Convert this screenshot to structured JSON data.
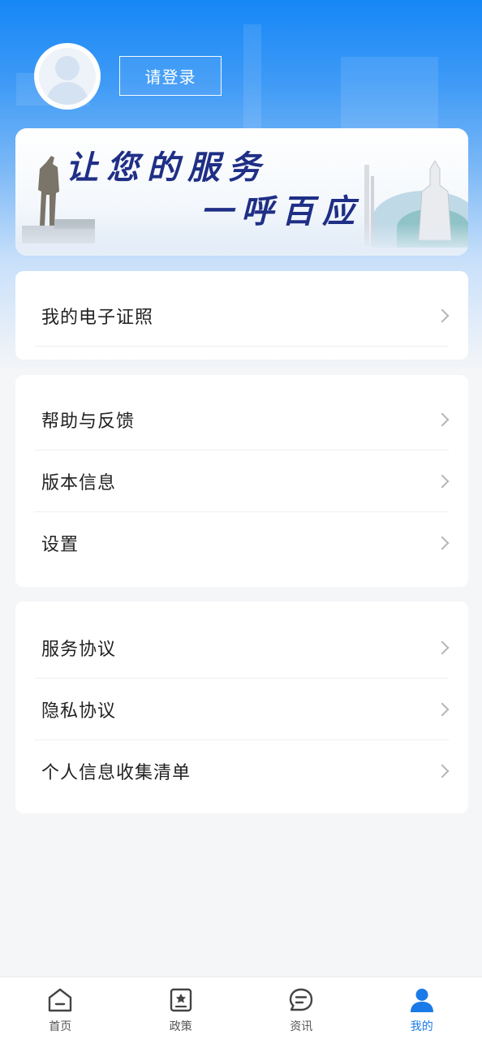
{
  "header": {
    "login_label": "请登录"
  },
  "banner": {
    "line1": "让您的服务",
    "line2": "一呼百应"
  },
  "menu_groups": [
    {
      "items": [
        {
          "label": "我的电子证照"
        }
      ]
    },
    {
      "items": [
        {
          "label": "帮助与反馈"
        },
        {
          "label": "版本信息"
        },
        {
          "label": "设置"
        }
      ]
    },
    {
      "items": [
        {
          "label": "服务协议"
        },
        {
          "label": "隐私协议"
        },
        {
          "label": "个人信息收集清单"
        }
      ]
    }
  ],
  "tabbar": {
    "tabs": [
      {
        "label": "首页",
        "icon": "home-icon"
      },
      {
        "label": "政策",
        "icon": "policy-icon"
      },
      {
        "label": "资讯",
        "icon": "news-icon"
      },
      {
        "label": "我的",
        "icon": "profile-icon",
        "active": true
      }
    ]
  },
  "colors": {
    "accent": "#1a7ae8",
    "header_top": "#1687f6",
    "banner_text": "#1f2f86"
  }
}
